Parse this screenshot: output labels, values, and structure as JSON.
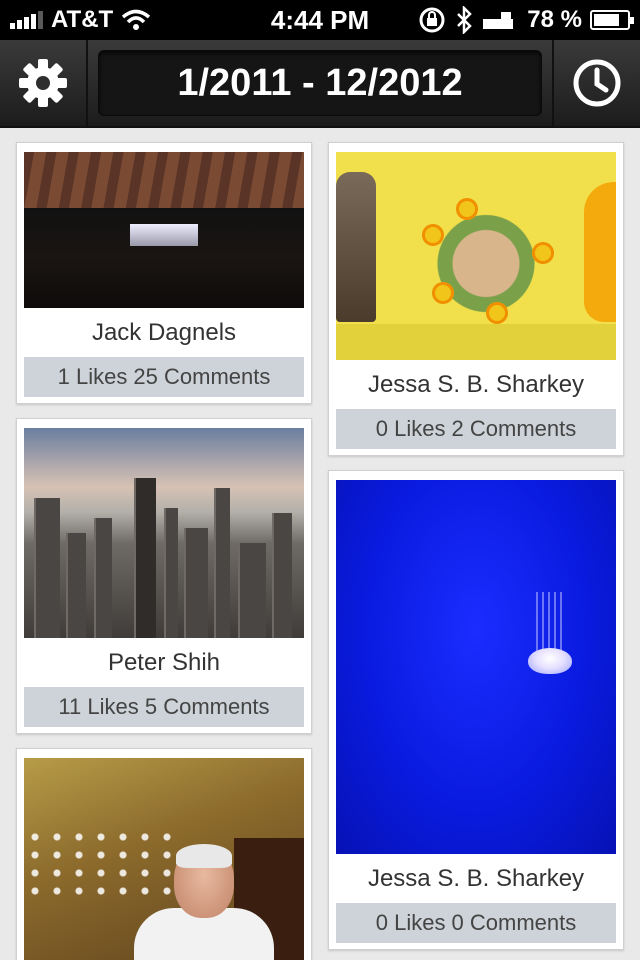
{
  "status_bar": {
    "carrier": "AT&T",
    "time": "4:44 PM",
    "battery": "78 %",
    "battery_level": 0.78,
    "icons": [
      "signal-bars-icon",
      "wifi-icon",
      "rotation-lock-icon",
      "bluetooth-icon",
      "battery-icon"
    ]
  },
  "nav": {
    "date_range": "1/2011 - 12/2012",
    "left_icon": "gear-icon",
    "right_icon": "clock-icon"
  },
  "colors": {
    "nav_bg": "#2a2a2a",
    "stats_bg": "#cdd3d8",
    "page_bg": "#e9e9e9"
  },
  "feed": {
    "left_column": [
      {
        "author": "Jack Dagnels",
        "stats": "1 Likes 25 Comments",
        "photo": "basketball-arena-photo"
      },
      {
        "author": "Peter Shih",
        "stats": "11 Likes 5 Comments",
        "photo": "city-skyline-photo"
      },
      {
        "author": "",
        "stats": "",
        "photo": "restaurant-portrait-photo"
      }
    ],
    "right_column": [
      {
        "author": "Jessa S. B. Sharkey",
        "stats": "0 Likes 2 Comments",
        "photo": "flower-frame-photo"
      },
      {
        "author": "Jessa S. B. Sharkey",
        "stats": "0 Likes 0 Comments",
        "photo": "jellyfish-photo"
      }
    ]
  }
}
